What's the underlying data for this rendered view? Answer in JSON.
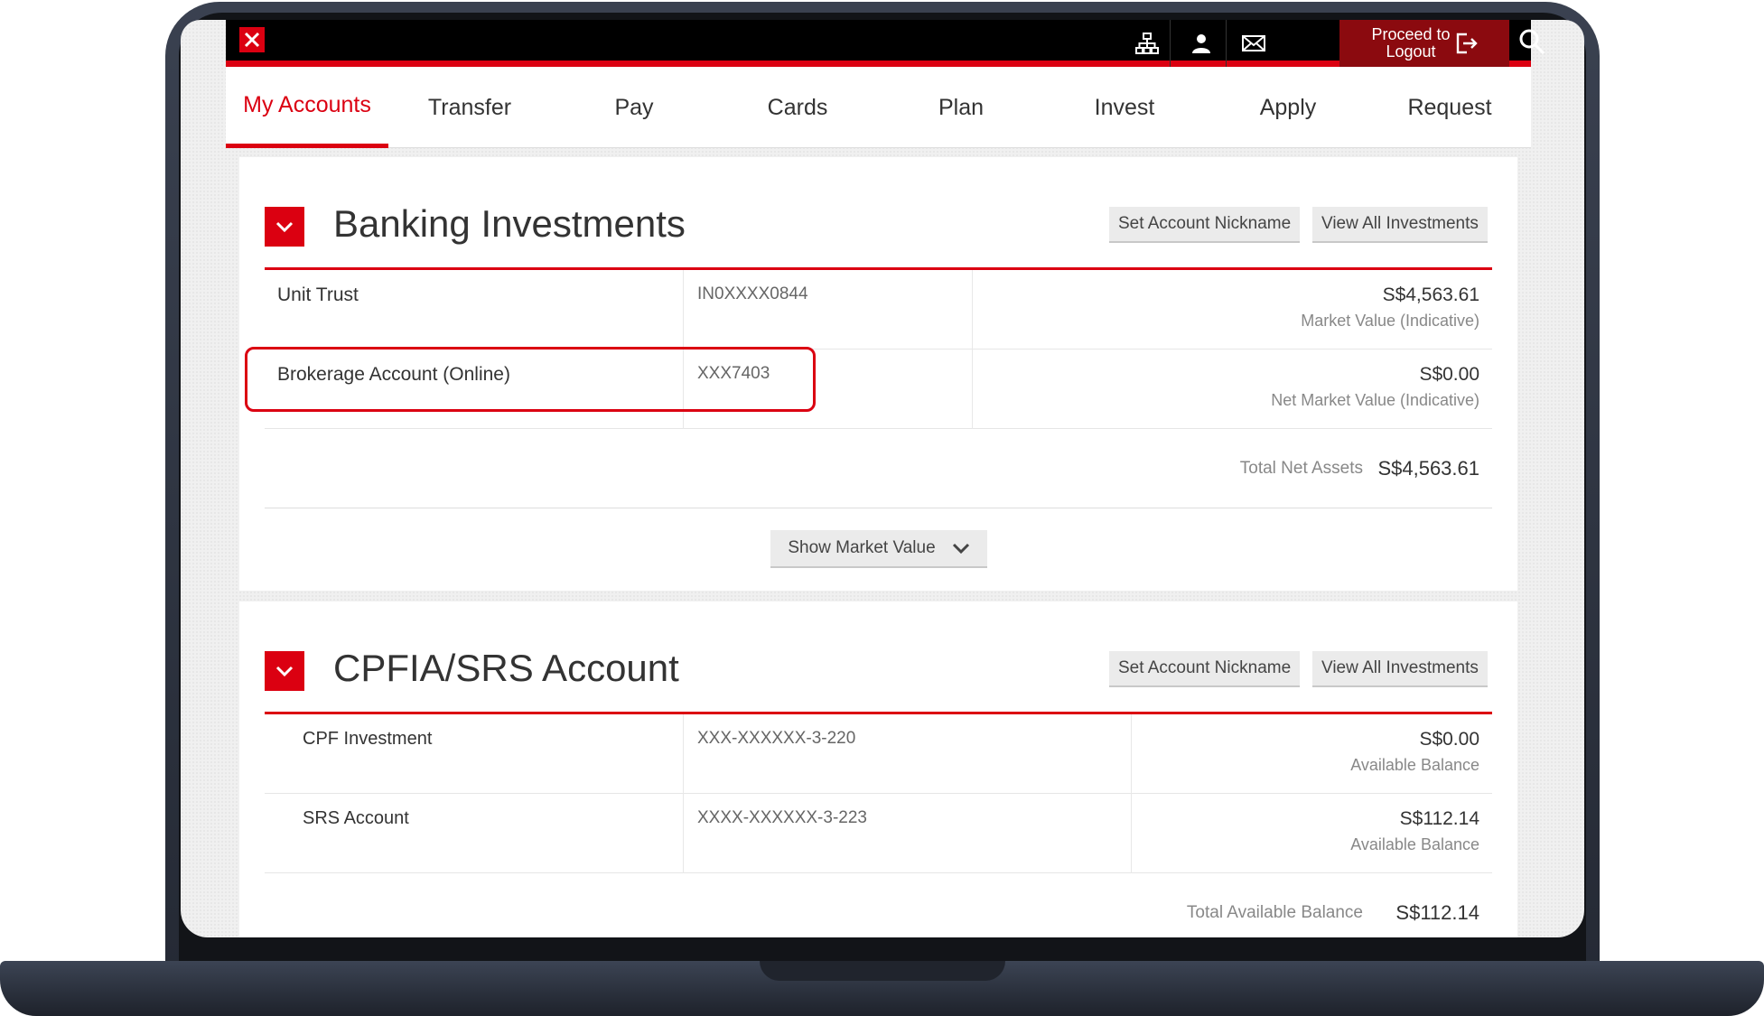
{
  "topbar": {
    "logout_line1": "Proceed to",
    "logout_line2": "Logout",
    "icons": [
      "sitemap-icon",
      "user-icon",
      "mail-icon",
      "logout-icon",
      "search-icon"
    ]
  },
  "nav": {
    "tabs": [
      {
        "label": "My Accounts",
        "active": true
      },
      {
        "label": "Transfer"
      },
      {
        "label": "Pay"
      },
      {
        "label": "Cards"
      },
      {
        "label": "Plan"
      },
      {
        "label": "Invest"
      },
      {
        "label": "Apply"
      },
      {
        "label": "Request"
      }
    ]
  },
  "banking": {
    "title": "Banking Investments",
    "nickname_btn": "Set Account Nickname",
    "view_all_btn": "View All Investments",
    "rows": [
      {
        "name": "Unit Trust",
        "number": "IN0XXXX0844",
        "amount": "S$4,563.61",
        "sub": "Market Value (Indicative)"
      },
      {
        "name": "Brokerage Account (Online)",
        "number": "XXX7403",
        "amount": "S$0.00",
        "sub": "Net Market Value (Indicative)"
      }
    ],
    "total_label": "Total Net Assets",
    "total_value": "S$4,563.61",
    "show_market_value": "Show Market Value"
  },
  "cpf": {
    "title": "CPFIA/SRS Account",
    "nickname_btn": "Set Account Nickname",
    "view_all_btn": "View All Investments",
    "rows": [
      {
        "name": "CPF Investment",
        "number": "XXX-XXXXXX-3-220",
        "amount": "S$0.00",
        "sub": "Available Balance"
      },
      {
        "name": "SRS Account",
        "number": "XXXX-XXXXXX-3-223",
        "amount": "S$112.14",
        "sub": "Available Balance"
      }
    ],
    "total_label": "Total Available Balance",
    "total_value": "S$112.14"
  },
  "colors": {
    "brand_red": "#db0011",
    "topbar": "#000000",
    "logout_bg": "#8b0a0f"
  }
}
